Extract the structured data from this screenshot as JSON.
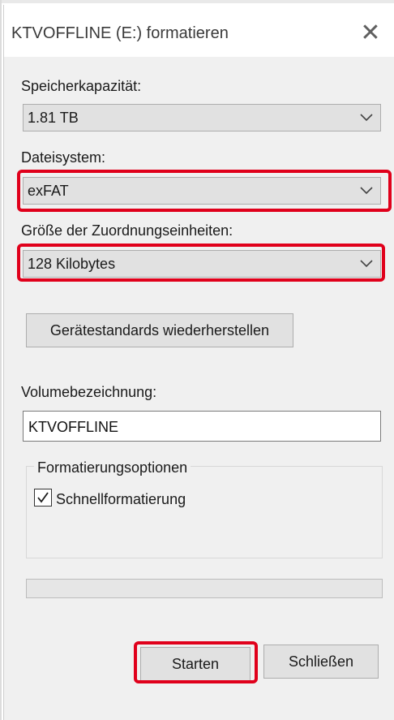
{
  "dialog": {
    "title": "KTVOFFLINE (E:) formatieren",
    "close_glyph": "✕"
  },
  "capacity": {
    "label": "Speicherkapazität:",
    "value": "1.81 TB"
  },
  "filesystem": {
    "label": "Dateisystem:",
    "value": "exFAT"
  },
  "allocation": {
    "label": "Größe der Zuordnungseinheiten:",
    "value": "128 Kilobytes"
  },
  "restore_defaults_label": "Gerätestandards wiederherstellen",
  "volume": {
    "label": "Volumebezeichnung:",
    "value": "KTVOFFLINE"
  },
  "options": {
    "legend": "Formatierungsoptionen",
    "quick_format_label": "Schnellformatierung",
    "quick_format_checked": true
  },
  "progress": {
    "percent": 0
  },
  "buttons": {
    "start": "Starten",
    "close": "Schließen"
  },
  "colors": {
    "highlight": "#e0001b",
    "dialog_bg": "#f0f0f0",
    "button_bg": "#e1e1e1"
  },
  "icons": {
    "close": "close-icon",
    "dropdown": "chevron-down-icon",
    "check": "checkmark-icon"
  }
}
